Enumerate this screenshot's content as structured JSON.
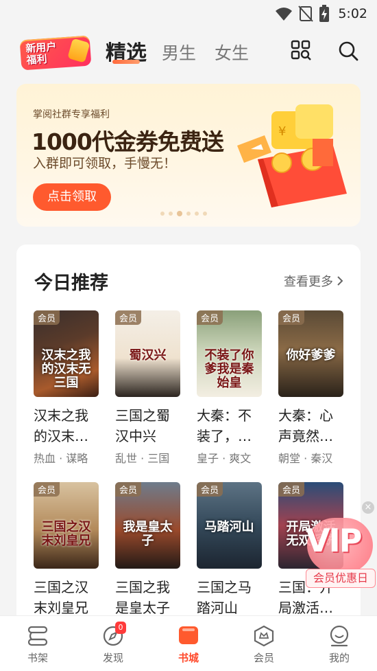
{
  "status_bar": {
    "time": "5:02"
  },
  "top_nav": {
    "promo_line1": "新用户",
    "promo_line2": "福利",
    "tabs": [
      {
        "label": "精选"
      },
      {
        "label": "男生"
      },
      {
        "label": "女生"
      }
    ]
  },
  "banner": {
    "subtitle": "掌阅社群专享福利",
    "title": "1000代金券免费送",
    "description": "入群即可领取，手慢无！",
    "button": "点击领取"
  },
  "recommend": {
    "title": "今日推荐",
    "more": "查看更多",
    "vip_tag": "会员",
    "books": [
      {
        "title": "汉末之我的汉末…",
        "tags": "热血 · 谋略",
        "cover_text": "汉末之我的汉末无三国"
      },
      {
        "title": "三国之蜀汉中兴",
        "tags": "乱世 · 三国",
        "cover_text": "蜀汉兴"
      },
      {
        "title": "大秦：不装了，…",
        "tags": "皇子 · 爽文",
        "cover_text": "不装了你爹我是秦始皇"
      },
      {
        "title": "大秦：心声竟然…",
        "tags": "朝堂 · 秦汉",
        "cover_text": "你好爹爹"
      },
      {
        "title": "三国之汉末刘皇兄",
        "tags": "",
        "cover_text": "三国之汉末刘皇兄"
      },
      {
        "title": "三国之我是皇太子",
        "tags": "",
        "cover_text": "我是皇太子"
      },
      {
        "title": "三国之马踏河山",
        "tags": "",
        "cover_text": "马踏河山"
      },
      {
        "title": "三国：开局激活…",
        "tags": "",
        "cover_text": "开局激活无双系统"
      }
    ]
  },
  "vip_float": {
    "letters": "VIP",
    "label": "会员优惠日"
  },
  "bottom_nav": {
    "items": [
      {
        "label": "书架"
      },
      {
        "label": "发现",
        "badge": "0"
      },
      {
        "label": "书城"
      },
      {
        "label": "会员"
      },
      {
        "label": "我的"
      }
    ]
  },
  "colors": {
    "accent": "#ff5a2e",
    "active_tab": "#ff4a2c"
  }
}
